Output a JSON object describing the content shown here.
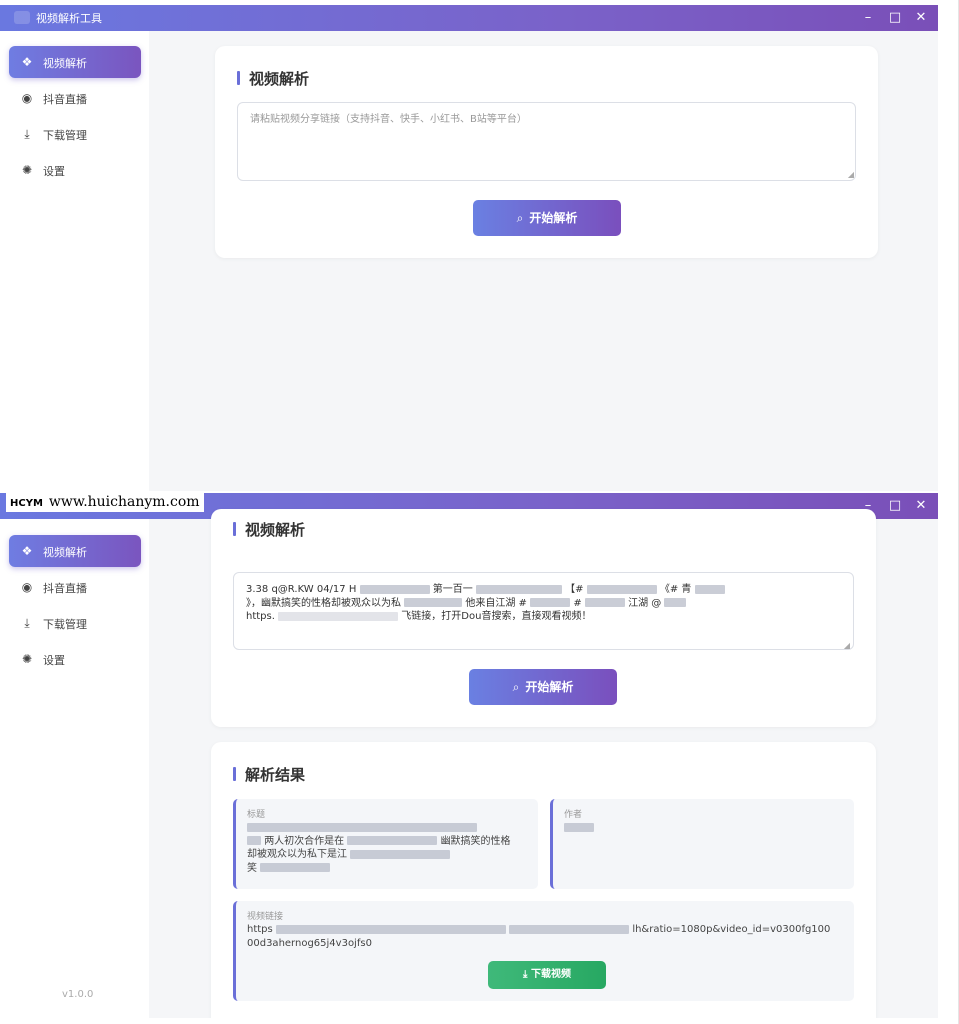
{
  "window": {
    "title": "视频解析工具",
    "controls": {
      "minimize": "–",
      "maximize": "□",
      "close": "✕"
    }
  },
  "sidebar": {
    "items": [
      {
        "label": "视频解析",
        "icon": "layers-icon",
        "glyph": "❖"
      },
      {
        "label": "抖音直播",
        "icon": "live-icon",
        "glyph": "◉"
      },
      {
        "label": "下载管理",
        "icon": "download-icon",
        "glyph": "⤓"
      },
      {
        "label": "设置",
        "icon": "gear-icon",
        "glyph": "✺"
      }
    ],
    "version": "v1.0.0"
  },
  "parse": {
    "title": "视频解析",
    "placeholder": "请粘贴视频分享链接（支持抖音、快手、小红书、B站等平台）",
    "input_value_line1": "3.38 q@R.KW 04/17 H",
    "input_value_line1b": "第一百一",
    "input_value_line1c": "【#",
    "input_value_line1d": "《# 青",
    "input_value_line2a": "》，幽默搞笑的性格却被观众以为私",
    "input_value_line2b": "他来自江湖 #",
    "input_value_line2c": "#",
    "input_value_line2d": "江湖 @",
    "input_value_line3a": "https.",
    "input_value_line3b": "飞链接，打开Dou音搜索，直接观看视频！",
    "button_label": "开始解析",
    "button_icon": "⌕"
  },
  "result": {
    "title": "解析结果",
    "title_field_label": "标题",
    "title_text_a": "两人初次合作是在",
    "title_text_b": "幽默搞笑的性格",
    "title_text_c": "却被观众以为私下是江",
    "title_text_d": "笑",
    "author_label": "作者",
    "link_label": "视频链接",
    "link_prefix": "https",
    "link_suffix": "lh&ratio=1080p&video_id=v0300fg100",
    "link_line2": "00d3ahernog65j4v3ojfs0",
    "download_label": "下载视频",
    "download_icon": "⤓"
  },
  "watermark": {
    "logo": "HCYM",
    "text": "www.huichanym.com"
  },
  "colors": {
    "accent": "#6a6fd8",
    "titlebar_start": "#6a78e0",
    "titlebar_end": "#7a4fb8",
    "download_green": "#27a862"
  }
}
